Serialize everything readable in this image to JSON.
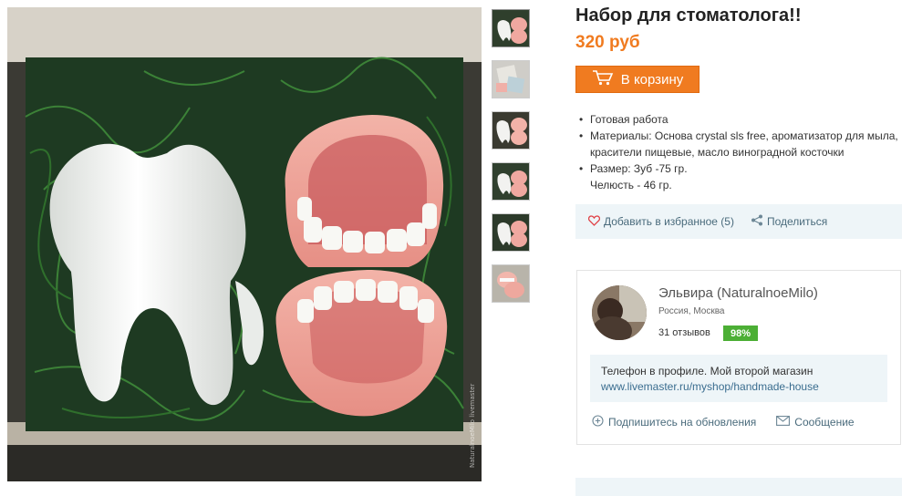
{
  "product": {
    "title": "Набор для стоматолога!!",
    "price": "320 руб",
    "cart_label": "В корзину",
    "photo_watermark": "NaturalnoeMilo livemaster",
    "specs": [
      {
        "text": "Готовая работа"
      },
      {
        "text": "Материалы: Основа crystal sls free, ароматизатор для мыла, красители пищевые, масло виноградной косточки"
      },
      {
        "text": "Размер: Зуб -75 гр."
      }
    ],
    "spec_continuation": "Челюсть - 46 гр."
  },
  "thumbnails": [
    "tooth-and-jaw",
    "soap-packaging",
    "tooth-and-jaw",
    "tooth-and-jaw",
    "tooth-and-jaw",
    "jaw-closeup"
  ],
  "actions": {
    "favorite_label": "Добавить в избранное (5)",
    "share_label": "Поделиться"
  },
  "seller": {
    "name": "Эльвира (NaturalnoeMilo)",
    "location": "Россия, Москва",
    "reviews": "31 отзывов",
    "rating": "98%",
    "note_line1": "Телефон в профиле. Мой второй магазин",
    "note_link": "www.livemaster.ru/myshop/handmade-house",
    "subscribe_label": "Подпишитесь на обновления",
    "message_label": "Сообщение"
  },
  "colors": {
    "accent": "#f07b20",
    "rating_badge": "#4caf35",
    "panel_bg": "#eef5f8",
    "link": "#3a6d8f"
  },
  "icons": [
    "cart-icon",
    "heart-icon",
    "share-icon",
    "plus-circle-icon",
    "envelope-icon"
  ]
}
